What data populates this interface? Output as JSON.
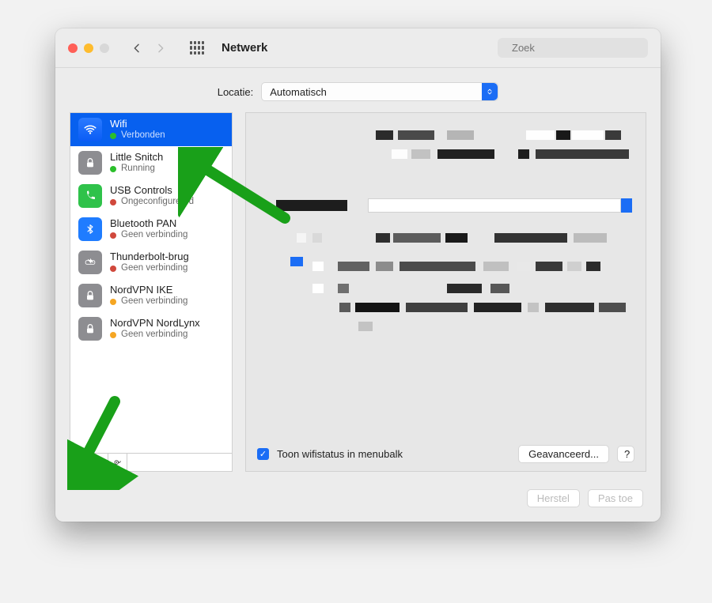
{
  "titlebar": {
    "title": "Netwerk",
    "search_placeholder": "Zoek"
  },
  "location": {
    "label": "Locatie:",
    "value": "Automatisch"
  },
  "services": [
    {
      "name": "Wifi",
      "status": "Verbonden",
      "dot": "sd-green",
      "iconClass": "ic-wifi",
      "iconName": "wifi-icon",
      "selected": true
    },
    {
      "name": "Little Snitch",
      "status": "Running",
      "dot": "sd-green",
      "iconClass": "ic-grey",
      "iconName": "lock-icon",
      "selected": false
    },
    {
      "name": "USB Controls",
      "status": "Ongeconfigureerd",
      "dot": "sd-red",
      "iconClass": "ic-green",
      "iconName": "phone-icon",
      "selected": false
    },
    {
      "name": "Bluetooth PAN",
      "status": "Geen verbinding",
      "dot": "sd-red",
      "iconClass": "ic-blue2",
      "iconName": "bluetooth-icon",
      "selected": false
    },
    {
      "name": "Thunderbolt-brug",
      "status": "Geen verbinding",
      "dot": "sd-red",
      "iconClass": "ic-grey",
      "iconName": "thunderbolt-icon",
      "selected": false
    },
    {
      "name": "NordVPN IKE",
      "status": "Geen verbinding",
      "dot": "sd-amber",
      "iconClass": "ic-grey",
      "iconName": "lock-icon",
      "selected": false
    },
    {
      "name": "NordVPN NordLynx",
      "status": "Geen verbinding",
      "dot": "sd-amber",
      "iconClass": "ic-grey",
      "iconName": "lock-icon",
      "selected": false
    }
  ],
  "details": {
    "checkbox_label": "Toon wifistatus in menubalk",
    "advanced_label": "Geavanceerd...",
    "help_label": "?"
  },
  "footer": {
    "revert_label": "Herstel",
    "apply_label": "Pas toe"
  }
}
